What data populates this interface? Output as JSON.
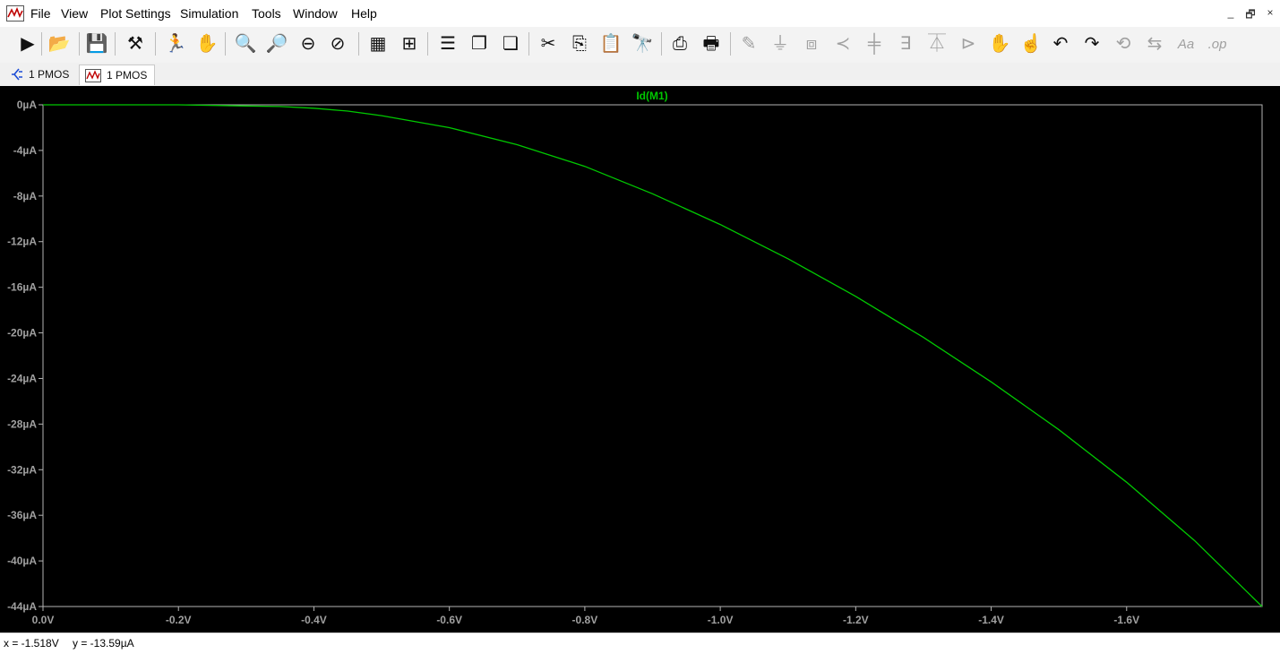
{
  "menu": {
    "items": [
      "File",
      "View",
      "Plot Settings",
      "Simulation",
      "Tools",
      "Window",
      "Help"
    ]
  },
  "window_controls": {
    "minimize": "_",
    "restore": "🗗",
    "close": "×"
  },
  "toolbar": {
    "icons": [
      {
        "name": "run-icon",
        "glyph": "▶"
      },
      {
        "name": "open-icon",
        "glyph": "📂"
      },
      {
        "name": "save-icon",
        "glyph": "💾"
      },
      {
        "name": "control-panel-icon",
        "glyph": "⚒"
      },
      {
        "name": "halt-icon",
        "glyph": "🏃"
      },
      {
        "name": "pan-icon",
        "glyph": "✋"
      },
      {
        "name": "zoom-in-icon",
        "glyph": "🔍"
      },
      {
        "name": "zoom-out-icon",
        "glyph": "🔎"
      },
      {
        "name": "zoom-minus-icon",
        "glyph": "⊖"
      },
      {
        "name": "zoom-cancel-icon",
        "glyph": "⊘"
      },
      {
        "name": "autorange-icon",
        "glyph": "▦"
      },
      {
        "name": "measure-icon",
        "glyph": "⊞"
      },
      {
        "name": "tile-horizontal-icon",
        "glyph": "☰"
      },
      {
        "name": "cascade-icon",
        "glyph": "❐"
      },
      {
        "name": "tile-vertical-icon",
        "glyph": "❏"
      },
      {
        "name": "cut-icon",
        "glyph": "✂"
      },
      {
        "name": "copy-icon",
        "glyph": "⎘"
      },
      {
        "name": "paste-icon",
        "glyph": "📋"
      },
      {
        "name": "find-icon",
        "glyph": "🔭"
      },
      {
        "name": "print-setup-icon",
        "glyph": "⎙"
      },
      {
        "name": "print-icon",
        "glyph": "🖶"
      },
      {
        "name": "wire-icon",
        "glyph": "✎"
      },
      {
        "name": "ground-icon",
        "glyph": "⏚"
      },
      {
        "name": "label-net-icon",
        "glyph": "⧈"
      },
      {
        "name": "resistor-icon",
        "glyph": "≺"
      },
      {
        "name": "capacitor-icon",
        "glyph": "╪"
      },
      {
        "name": "inductor-icon",
        "glyph": "∃"
      },
      {
        "name": "diode-icon",
        "glyph": "⏄"
      },
      {
        "name": "component-icon",
        "glyph": "⊳"
      },
      {
        "name": "move-icon",
        "glyph": "✋"
      },
      {
        "name": "drag-icon",
        "glyph": "☝"
      },
      {
        "name": "undo-icon",
        "glyph": "↶"
      },
      {
        "name": "redo-icon",
        "glyph": "↷"
      },
      {
        "name": "rotate-icon",
        "glyph": "⟲"
      },
      {
        "name": "mirror-icon",
        "glyph": "⇆"
      },
      {
        "name": "text-icon",
        "glyph": "Aa"
      },
      {
        "name": "spice-directive-icon",
        "glyph": ".op"
      }
    ]
  },
  "tabs": [
    {
      "label": "1 PMOS",
      "icon": "schematic-icon"
    },
    {
      "label": "1 PMOS",
      "icon": "waveform-icon"
    }
  ],
  "chart_data": {
    "type": "line",
    "title": "",
    "xlabel": "",
    "ylabel": "",
    "xlim": [
      0.0,
      -1.8
    ],
    "ylim": [
      0,
      -44
    ],
    "x_ticks": [
      "0.0V",
      "-0.2V",
      "-0.4V",
      "-0.6V",
      "-0.8V",
      "-1.0V",
      "-1.2V",
      "-1.4V",
      "-1.6V"
    ],
    "x_tick_values": [
      0.0,
      -0.2,
      -0.4,
      -0.6,
      -0.8,
      -1.0,
      -1.2,
      -1.4,
      -1.6
    ],
    "y_ticks": [
      "0µA",
      "-4µA",
      "-8µA",
      "-12µA",
      "-16µA",
      "-20µA",
      "-24µA",
      "-28µA",
      "-32µA",
      "-36µA",
      "-40µA",
      "-44µA"
    ],
    "y_tick_values": [
      0,
      -4,
      -8,
      -12,
      -16,
      -20,
      -24,
      -28,
      -32,
      -36,
      -40,
      -44
    ],
    "grid": false,
    "background": "#000000",
    "axis_color": "#b4b4b4",
    "tick_label_color": "#a0a0a0",
    "series": [
      {
        "name": "Id(M1)",
        "color": "#00c800",
        "x": [
          0.0,
          -0.1,
          -0.2,
          -0.3,
          -0.35,
          -0.4,
          -0.45,
          -0.5,
          -0.6,
          -0.7,
          -0.8,
          -0.9,
          -1.0,
          -1.1,
          -1.2,
          -1.3,
          -1.4,
          -1.5,
          -1.6,
          -1.7,
          -1.8
        ],
        "y": [
          0,
          0,
          0,
          -0.1,
          -0.15,
          -0.3,
          -0.55,
          -0.95,
          -2.0,
          -3.5,
          -5.4,
          -7.8,
          -10.5,
          -13.5,
          -16.8,
          -20.4,
          -24.3,
          -28.5,
          -33.1,
          -38.2,
          -44.0
        ]
      }
    ]
  },
  "status": {
    "x_readout": "x = -1.518V",
    "y_readout": "y = -13.59µA"
  }
}
